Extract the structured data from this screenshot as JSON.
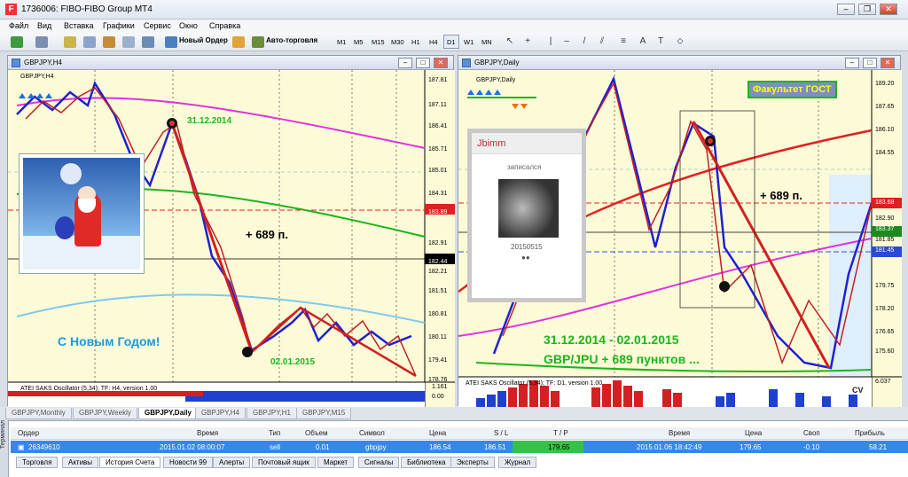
{
  "window": {
    "title": "1736006: FIBO-FIBO Group MT4",
    "app_icon": "F"
  },
  "menu": [
    "Файл",
    "Вид",
    "Вставка",
    "Графики",
    "Сервис",
    "Окно",
    "Справка"
  ],
  "toolbar": {
    "new_order": "Новый Ордер",
    "auto_trading": "Авто-торговля",
    "timeframes": [
      "M1",
      "M5",
      "M15",
      "M30",
      "H1",
      "H4",
      "D1",
      "W1",
      "MN"
    ],
    "active_timeframe": "D1",
    "draw_tools": [
      "cursor-icon",
      "crosshair-icon",
      "vertical-line-icon",
      "horizontal-line-icon",
      "trendline-icon",
      "channel-icon",
      "fibo-icon",
      "text-icon",
      "label-icon",
      "shapes-icon"
    ]
  },
  "chart_left": {
    "window_title": "GBPJPY,H4",
    "symbol_label": "GBPJPY,H4",
    "price_ticks": [
      "187.81",
      "187.11",
      "186.41",
      "185.71",
      "185.01",
      "184.31",
      "183.89",
      "182.91",
      "182.44",
      "182.21",
      "181.51",
      "180.81",
      "180.11",
      "179.41",
      "178.76"
    ],
    "date1": "31.12.2014",
    "date2": "02.01.2015",
    "points": "+ 689 п.",
    "greeting": "С Новым Годом!",
    "indicator_label": "ATEI SAKS Oscillator (5,34); TF: H4, version 1.00",
    "osc_ticks": [
      "1.161",
      "0.00"
    ]
  },
  "chart_right": {
    "window_title": "GBPJPY,Daily",
    "symbol_label": "GBPJPY,Daily",
    "price_ticks": [
      "189.20",
      "187.65",
      "186.10",
      "184.55",
      "183.68",
      "182.90",
      "181.85",
      "181.45",
      "179.75",
      "178.20",
      "176.65",
      "175.60"
    ],
    "price_tag_green": "183.37",
    "banner": "Факультет ГОСТ",
    "points": "+ 689 п.",
    "caption1": "31.12.2014 - 02.01.2015",
    "caption2": "GBP/JPU  + 689 пунктов ...",
    "indicator_label": "ATEI SAKS Oscillator (5,34); TF: D1, version 1.00",
    "osc_tick": "6.037",
    "cv": "CV",
    "card": {
      "name": "Jbimm",
      "status": "записался",
      "date": "20150515",
      "dots": "●●"
    }
  },
  "chart_tabs": [
    "GBPJPY,Monthly",
    "GBPJPY,Weekly",
    "GBPJPY,Daily",
    "GBPJPY,H4",
    "GBPJPY,H1",
    "GBPJPY,M15"
  ],
  "selected_chart_tab": "GBPJPY,Daily",
  "terminal": {
    "side_label": "Терминал",
    "headers": [
      "Ордер",
      "Время",
      "Тип",
      "Объем",
      "Символ",
      "Цена",
      "S / L",
      "T / P",
      "Время",
      "Цена",
      "Своп",
      "Прибыль"
    ],
    "row": {
      "order": "26349610",
      "open_time": "2015.01.02 08:00:07",
      "type": "sell",
      "volume": "0.01",
      "symbol": "gbpjpy",
      "price": "186.54",
      "sl": "186.51",
      "tp": "179.65",
      "close_time": "2015.01.06 18:42:49",
      "close_price": "179.65",
      "swap": "-0.10",
      "profit": "58.21"
    },
    "tabs": [
      "Торговля",
      "Активы",
      "История Счета",
      "Новости 99",
      "Алерты",
      "Почтовый ящик",
      "Маркет",
      "Сигналы",
      "Библиотека",
      "Эксперты",
      "Журнал"
    ],
    "selected_tab": "История Счета"
  }
}
